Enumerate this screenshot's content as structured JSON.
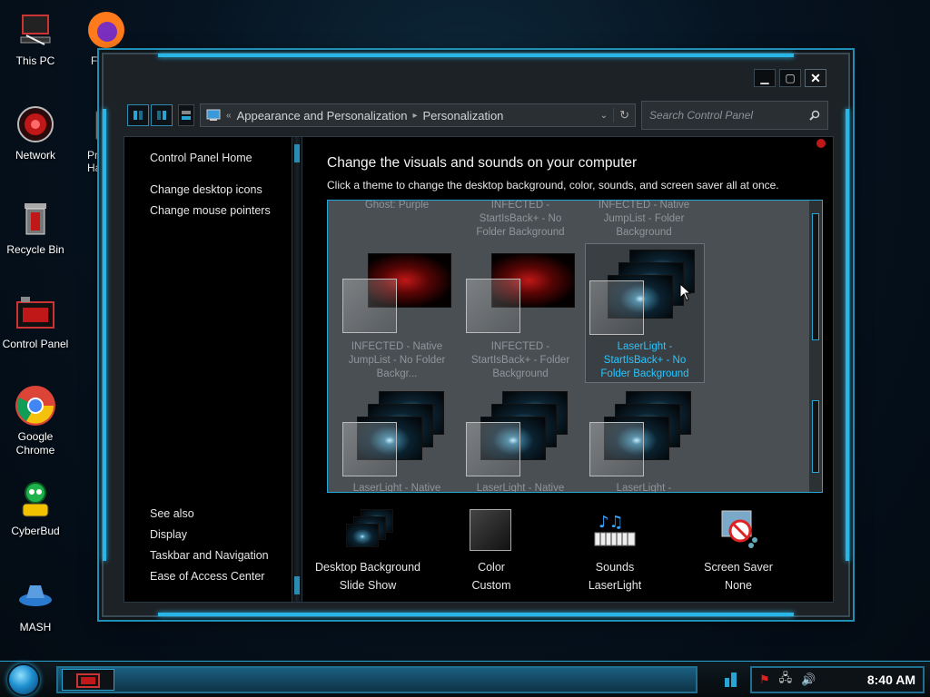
{
  "desktop": {
    "icons": [
      {
        "label": "This PC"
      },
      {
        "label": "Network"
      },
      {
        "label": "Recycle Bin"
      },
      {
        "label": "Control Panel"
      },
      {
        "label": "Google Chrome"
      },
      {
        "label": "CyberBud"
      },
      {
        "label": "MASH"
      },
      {
        "label": "Fir"
      },
      {
        "label": "Pro"
      },
      {
        "label": "Had"
      }
    ]
  },
  "window": {
    "caption_buttons": {
      "minimize": "▁",
      "maximize": "▢",
      "close": "✕"
    },
    "address": {
      "overflow": "«",
      "segments": [
        "Appearance and Personalization",
        "Personalization"
      ]
    },
    "search": {
      "placeholder": "Search Control Panel"
    },
    "left_pane": {
      "links": [
        "Control Panel Home",
        "Change desktop icons",
        "Change mouse pointers"
      ],
      "see_also_header": "See also",
      "see_also": [
        "Display",
        "Taskbar and Navigation",
        "Ease of Access Center"
      ]
    },
    "main": {
      "title": "Change the visuals and sounds on your computer",
      "description": "Click a theme to change the desktop background, color, sounds, and screen saver all at once."
    },
    "themes": [
      {
        "title": "Ghost: Purple",
        "style": "none"
      },
      {
        "title": "INFECTED - StartIsBack+ - No Folder Background",
        "style": "none"
      },
      {
        "title": "INFECTED - Native JumpList - Folder Background",
        "style": "none"
      },
      {
        "title": "INFECTED - Native JumpList - No Folder Backgr...",
        "style": "red"
      },
      {
        "title": "INFECTED - StartIsBack+ - Folder Background",
        "style": "red"
      },
      {
        "title": "LaserLight - StartIsBack+ - No Folder Background",
        "style": "laser",
        "selected": true
      },
      {
        "title": "LaserLight - Native",
        "style": "laser"
      },
      {
        "title": "LaserLight - Native",
        "style": "laser"
      },
      {
        "title": "LaserLight -",
        "style": "laser"
      }
    ],
    "bottom": [
      {
        "label": "Desktop Background",
        "value": "Slide Show",
        "icon": "desktop-background-icon"
      },
      {
        "label": "Color",
        "value": "Custom",
        "icon": "color-icon"
      },
      {
        "label": "Sounds",
        "value": "LaserLight",
        "icon": "sounds-icon"
      },
      {
        "label": "Screen Saver",
        "value": "None",
        "icon": "screen-saver-icon"
      }
    ]
  },
  "taskbar": {
    "clock": "8:40 AM"
  },
  "colors": {
    "accent": "#29a5d3",
    "selected_text": "#29c5ff"
  }
}
